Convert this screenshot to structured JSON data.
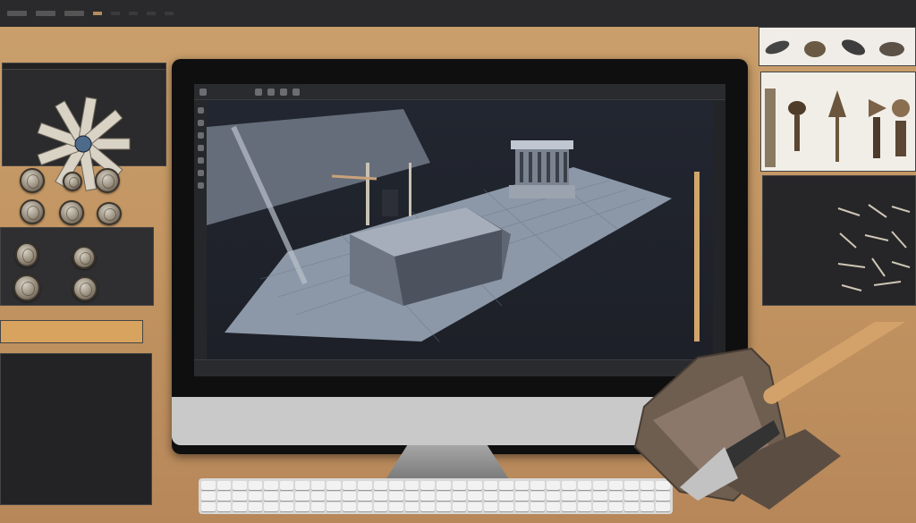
{
  "top_bar": {
    "tabs": [
      "",
      "",
      "",
      "",
      ""
    ]
  },
  "left": {
    "panel1_title": "",
    "list_rows": [
      "",
      "",
      "",
      "",
      "",
      "",
      "",
      "",
      ""
    ]
  },
  "app": {
    "menus": [
      "",
      "",
      "",
      "",
      "",
      "",
      "",
      ""
    ],
    "tabs": [
      "",
      "",
      ""
    ],
    "status": [
      "",
      "",
      "",
      ""
    ]
  },
  "right": {
    "rows": [
      "",
      "",
      "",
      "",
      "",
      "",
      "",
      "",
      "",
      ""
    ]
  },
  "icons": [
    "artifact-thumbnail",
    "coin-icon",
    "tool-icon",
    "brush-icon",
    "stone-icon"
  ],
  "colors": {
    "background": "#c79a63",
    "panel": "#2b2b2d",
    "viewport": "#1d2027",
    "highlight": "#d8a35f",
    "model": "#7f8a99"
  }
}
